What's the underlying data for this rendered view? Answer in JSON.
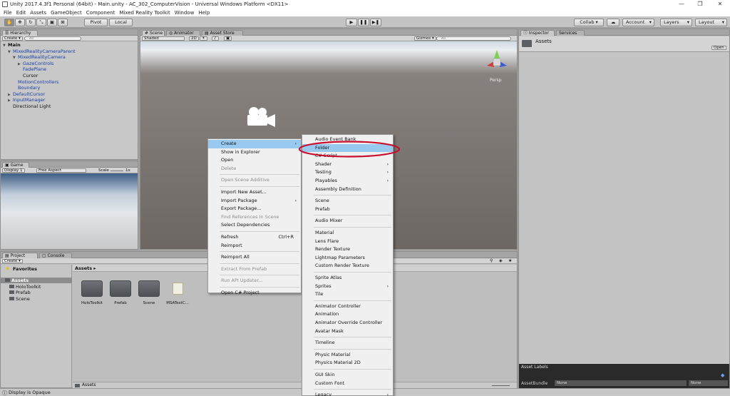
{
  "window": {
    "title": "Unity 2017.4.3f1 Personal (64bit) - Main.unity - AC_302_ComputerVision - Universal Windows Platform <DX11>",
    "controls": [
      "—",
      "❐",
      "✕"
    ]
  },
  "menubar": [
    "File",
    "Edit",
    "Assets",
    "GameObject",
    "Component",
    "Mixed Reality Toolkit",
    "Window",
    "Help"
  ],
  "toolbar": {
    "pivot": "Pivot",
    "local": "Local",
    "collab": "Collab ▾",
    "account": "Account",
    "layers": "Layers",
    "layout": "Layout",
    "dropdown_caret": "▾",
    "play_icons": [
      "▶",
      "❚❚",
      "▶❚"
    ]
  },
  "hierarchy": {
    "tab": "Hierarchy",
    "create": "Create ▾",
    "search_placeholder": "All",
    "items": [
      {
        "label": "Main",
        "bold": true,
        "blue": false,
        "indent": 0,
        "arrow": "▼"
      },
      {
        "label": "MixedRealityCameraParent",
        "blue": true,
        "indent": 1,
        "arrow": "▼"
      },
      {
        "label": "MixedRealityCamera",
        "blue": true,
        "indent": 2,
        "arrow": "▼"
      },
      {
        "label": "GazeControls",
        "blue": true,
        "indent": 3,
        "arrow": "▶"
      },
      {
        "label": "FadePlane",
        "blue": true,
        "indent": 3,
        "arrow": ""
      },
      {
        "label": "Cursor",
        "blue": false,
        "indent": 3,
        "arrow": ""
      },
      {
        "label": "MotionControllers",
        "blue": true,
        "indent": 2,
        "arrow": ""
      },
      {
        "label": "Boundary",
        "blue": true,
        "indent": 2,
        "arrow": ""
      },
      {
        "label": "DefaultCursor",
        "blue": true,
        "indent": 1,
        "arrow": "▶"
      },
      {
        "label": "InputManager",
        "blue": true,
        "indent": 1,
        "arrow": "▶"
      },
      {
        "label": "Directional Light",
        "blue": false,
        "indent": 1,
        "arrow": ""
      }
    ]
  },
  "scene_tabs": {
    "scene": "Scene",
    "animator": "Animator",
    "asset_store": "Asset Store"
  },
  "scene_bar": {
    "shaded": "Shaded",
    "mode_2d": "2D",
    "gizmos": "Gizmos ▾",
    "search_placeholder": "All",
    "persp": "Persp"
  },
  "game": {
    "tab": "Game",
    "display": "Display 1",
    "aspect": "Free Aspect",
    "scale_label": "Scale",
    "scale_value": "1x"
  },
  "project": {
    "tab": "Project",
    "console_tab": "Console",
    "create": "Create ▾",
    "favorites": "Favorites",
    "breadcrumb": "Assets ▸",
    "tree": [
      {
        "label": "Assets",
        "selected": true,
        "indent": 0
      },
      {
        "label": "HoloToolkit",
        "selected": false,
        "indent": 1
      },
      {
        "label": "Prefab",
        "selected": false,
        "indent": 1
      },
      {
        "label": "Scene",
        "selected": false,
        "indent": 1
      }
    ],
    "assets": [
      "HoloToolkit",
      "Prefab",
      "Scene",
      "MSATestC..."
    ],
    "footer_path": "Assets"
  },
  "inspector": {
    "tab": "Inspector",
    "services_tab": "Services",
    "title": "Assets",
    "open_button": "Open",
    "asset_labels": "Asset Labels",
    "asset_bundle": "AssetBundle",
    "bundle_value": "None",
    "variant_value": "None"
  },
  "context_menu": [
    {
      "label": "Create",
      "highlighted": true,
      "submenu": true
    },
    {
      "label": "Show in Explorer"
    },
    {
      "label": "Open"
    },
    {
      "label": "Delete",
      "disabled": true
    },
    {
      "sep": true
    },
    {
      "label": "Open Scene Additive",
      "disabled": true
    },
    {
      "sep": true
    },
    {
      "label": "Import New Asset..."
    },
    {
      "label": "Import Package",
      "submenu": true
    },
    {
      "label": "Export Package..."
    },
    {
      "label": "Find References In Scene",
      "disabled": true
    },
    {
      "label": "Select Dependencies"
    },
    {
      "sep": true
    },
    {
      "label": "Refresh",
      "shortcut": "Ctrl+R"
    },
    {
      "label": "Reimport"
    },
    {
      "sep": true
    },
    {
      "label": "Reimport All"
    },
    {
      "sep": true
    },
    {
      "label": "Extract From Prefab",
      "disabled": true
    },
    {
      "sep": true
    },
    {
      "label": "Run API Updater...",
      "disabled": true
    },
    {
      "sep": true
    },
    {
      "label": "Open C# Project"
    }
  ],
  "create_submenu": [
    {
      "label": "Audio Event Bank"
    },
    {
      "label": "Folder",
      "highlighted": true
    },
    {
      "label": "C# Script"
    },
    {
      "label": "Shader",
      "submenu": true
    },
    {
      "label": "Testing",
      "submenu": true
    },
    {
      "label": "Playables",
      "submenu": true
    },
    {
      "label": "Assembly Definition"
    },
    {
      "sep": true
    },
    {
      "label": "Scene"
    },
    {
      "label": "Prefab"
    },
    {
      "sep": true
    },
    {
      "label": "Audio Mixer"
    },
    {
      "sep": true
    },
    {
      "label": "Material"
    },
    {
      "label": "Lens Flare"
    },
    {
      "label": "Render Texture"
    },
    {
      "label": "Lightmap Parameters"
    },
    {
      "label": "Custom Render Texture"
    },
    {
      "sep": true
    },
    {
      "label": "Sprite Atlas"
    },
    {
      "label": "Sprites",
      "submenu": true
    },
    {
      "label": "Tile"
    },
    {
      "sep": true
    },
    {
      "label": "Animator Controller"
    },
    {
      "label": "Animation"
    },
    {
      "label": "Animator Override Controller"
    },
    {
      "label": "Avatar Mask"
    },
    {
      "sep": true
    },
    {
      "label": "Timeline"
    },
    {
      "sep": true
    },
    {
      "label": "Physic Material"
    },
    {
      "label": "Physics Material 2D"
    },
    {
      "sep": true
    },
    {
      "label": "GUI Skin"
    },
    {
      "label": "Custom Font"
    },
    {
      "sep": true
    },
    {
      "label": "Legacy",
      "submenu": true
    }
  ],
  "status": "Display is Opaque",
  "colors": {
    "highlight": "#99c9ef",
    "annotation_ring": "#c8102e",
    "hierarchy_blue": "#1a3ea8"
  }
}
